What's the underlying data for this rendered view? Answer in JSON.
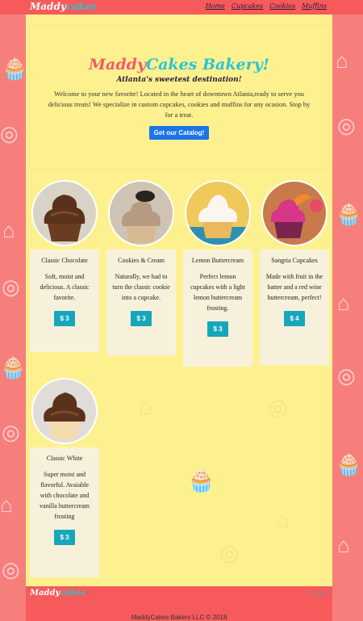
{
  "nav": {
    "brand_part1": "Maddy",
    "brand_part2": "cakes",
    "links": [
      "Home",
      "Cupcakes",
      "Cookies",
      "Muffins"
    ]
  },
  "hero": {
    "title_part1": "Maddy",
    "title_part2": "Cakes Bakery!",
    "subtitle": "Atlanta's sweetest destination!",
    "text": "Welcome to your new favorite! Located in the heart of downtown Atlanta,ready to serve you delicious treats! We specialize in custom cupcakes, cookies and muffins for any ocasion. Stop by for a treat.",
    "button": "Get our Catalog!"
  },
  "products": [
    {
      "name": "Classic Chocolate",
      "description": "Soft, moist and delicious. A classic favorite.",
      "price": "$ 3"
    },
    {
      "name": "Cookies & Cream",
      "description": "Naturally, we had to turn the classic cookie into a cupcake.",
      "price": "$ 3"
    },
    {
      "name": "Lemon Buttercream",
      "description": "Perfect lemon cupcakes with a light lemon buttercream frosting.",
      "price": "$ 3"
    },
    {
      "name": "Sangria Cupcakes",
      "description": "Made with fruit in the batter and a red wine buttercream, perfect!",
      "price": "$ 4"
    },
    {
      "name": "Classic White",
      "description": "Super moist and flavorful. Avaiable with chocolate and vanilla buttercream frosting",
      "price": "$ 3"
    }
  ],
  "footer": {
    "brand_part1": "Maddy",
    "brand_part2": "cakes",
    "socials": [
      "f",
      "t",
      "p",
      "i"
    ],
    "copyright": "MaddyCakes Bakers LLC © 2018"
  },
  "colors": {
    "background": "#f77f7b",
    "navbar": "#f75a5a",
    "content": "#fdf18f",
    "accent_blue": "#1b74e8",
    "accent_teal": "#17a7bb"
  }
}
